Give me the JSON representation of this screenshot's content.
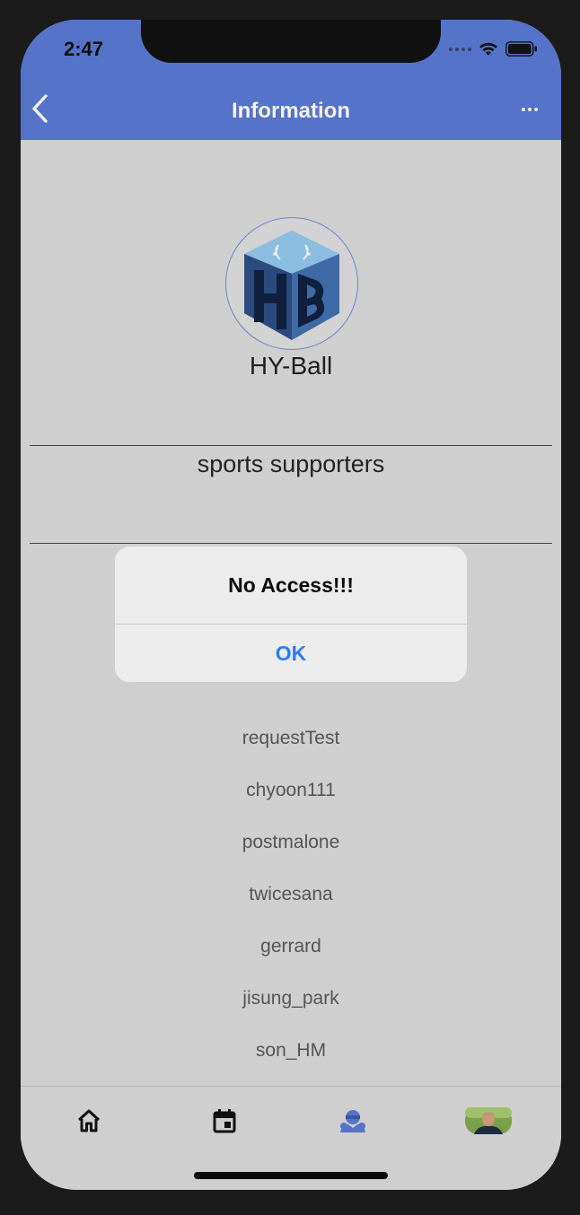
{
  "status_bar": {
    "time": "2:47"
  },
  "nav": {
    "title": "Information",
    "back_icon": "chevron-left-icon",
    "more_icon": "ellipsis-icon"
  },
  "group": {
    "logo_text": "HB",
    "name": "HY-Ball",
    "description": "sports supporters"
  },
  "members": [
    "requestTest",
    "chyoon111",
    "postmalone",
    "twicesana",
    "gerrard",
    "jisung_park",
    "son_HM",
    "..."
  ],
  "alert": {
    "title": "No Access!!!",
    "ok_label": "OK"
  },
  "tabs": [
    {
      "icon": "home-icon",
      "active": false
    },
    {
      "icon": "calendar-icon",
      "active": false
    },
    {
      "icon": "team-icon",
      "active": true
    },
    {
      "icon": "profile-avatar-icon",
      "active": false
    }
  ],
  "colors": {
    "header": "#5573c8",
    "background": "#cfcfcf",
    "alert_button": "#2e7cf6",
    "active_tab": "#5573c8"
  }
}
